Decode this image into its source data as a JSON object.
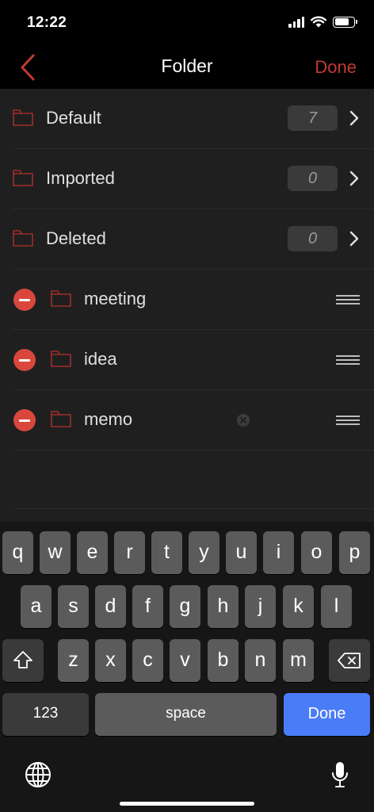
{
  "status_bar": {
    "time": "12:22"
  },
  "nav": {
    "title": "Folder",
    "done_label": "Done"
  },
  "folders": [
    {
      "label": "Default",
      "count": "7"
    },
    {
      "label": "Imported",
      "count": "0"
    },
    {
      "label": "Deleted",
      "count": "0"
    }
  ],
  "editable_folders": [
    {
      "label": "meeting"
    },
    {
      "label": "idea"
    },
    {
      "label": "memo"
    }
  ],
  "keyboard": {
    "row1": [
      "q",
      "w",
      "e",
      "r",
      "t",
      "y",
      "u",
      "i",
      "o",
      "p"
    ],
    "row2": [
      "a",
      "s",
      "d",
      "f",
      "g",
      "h",
      "j",
      "k",
      "l"
    ],
    "row3": [
      "z",
      "x",
      "c",
      "v",
      "b",
      "n",
      "m"
    ],
    "numbers_label": "123",
    "space_label": "space",
    "done_label": "Done"
  },
  "colors": {
    "accent_red": "#c23a33",
    "delete_red": "#d9473c",
    "keyboard_done_blue": "#4a7cf7",
    "list_background": "#1f1f1f"
  }
}
